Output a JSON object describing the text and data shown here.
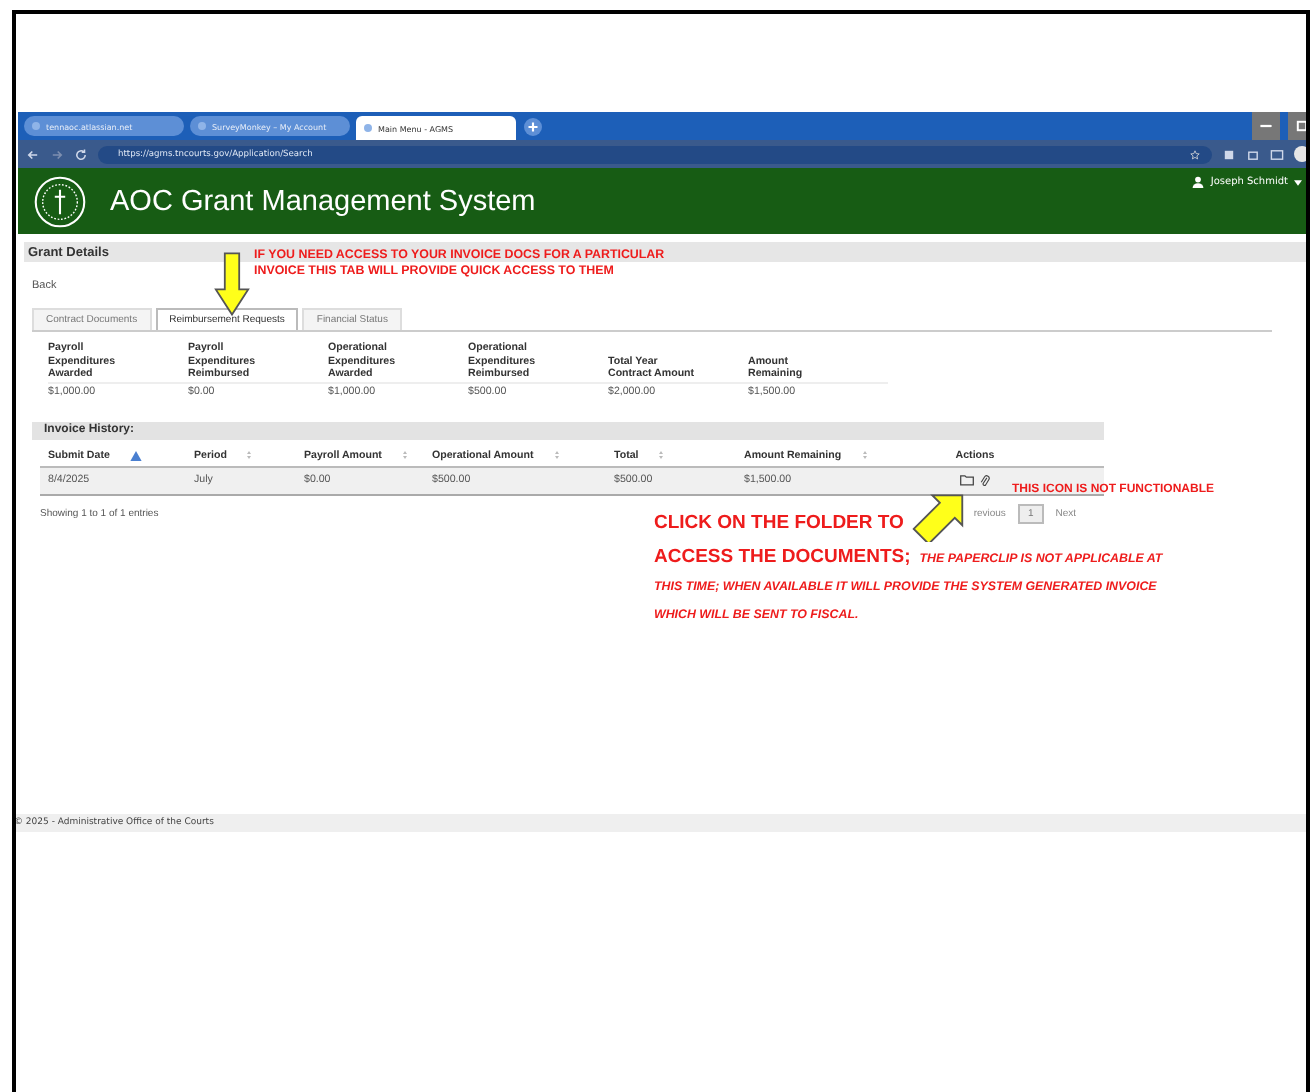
{
  "browser": {
    "tabs": [
      {
        "label": "tennaoc.atlassian.net",
        "selected": false
      },
      {
        "label": "SurveyMonkey – My Account",
        "selected": false
      },
      {
        "label": "Main Menu - AGMS",
        "selected": true
      }
    ],
    "url": "https://agms.tncourts.gov/Application/Search"
  },
  "app": {
    "title": "AOC Grant Management System",
    "user": "Joseph Schmidt"
  },
  "page": {
    "heading": "Grant Details",
    "back": "Back",
    "tabs": [
      {
        "label": "Contract Documents",
        "selected": false
      },
      {
        "label": "Reimbursement Requests",
        "selected": true
      },
      {
        "label": "Financial Status",
        "selected": false
      }
    ],
    "summary": [
      {
        "label": "Payroll Expenditures Awarded",
        "value": "$1,000.00"
      },
      {
        "label": "Payroll Expenditures Reimbursed",
        "value": "$0.00"
      },
      {
        "label": "Operational Expenditures Awarded",
        "value": "$1,000.00"
      },
      {
        "label": "Operational Expenditures Reimbursed",
        "value": "$500.00"
      },
      {
        "label": "Total Year Contract Amount",
        "value": "$2,000.00"
      },
      {
        "label": "Amount Remaining",
        "value": "$1,500.00"
      }
    ],
    "invoice_title": "Invoice History:",
    "table": {
      "columns": [
        {
          "label": "Submit Date",
          "sortable": true,
          "sorted": true
        },
        {
          "label": "Period",
          "sortable": true,
          "sorted": false
        },
        {
          "label": "Payroll Amount",
          "sortable": true,
          "sorted": false
        },
        {
          "label": "Operational Amount",
          "sortable": true,
          "sorted": false
        },
        {
          "label": "Total",
          "sortable": true,
          "sorted": false
        },
        {
          "label": "Amount Remaining",
          "sortable": true,
          "sorted": false
        },
        {
          "label": "Actions",
          "sortable": false
        }
      ],
      "rows": [
        {
          "cells": [
            "8/4/2025",
            "July",
            "$0.00",
            "$500.00",
            "$500.00",
            "$1,500.00"
          ]
        }
      ]
    },
    "showing": "Showing 1 to 1 of 1 entries",
    "pagination": {
      "previous": "revious",
      "pages": [
        {
          "label": "1",
          "selected": true
        }
      ],
      "next": "Next"
    },
    "footer": "© 2025 - Administrative Office of the Courts"
  },
  "annotations": {
    "tab_note": "IF YOU NEED ACCESS TO YOUR INVOICE DOCS FOR A PARTICULAR INVOICE THIS TAB WILL PROVIDE QUICK ACCESS TO THEM",
    "icon_note": "THIS ICON IS NOT FUNCTIONABLE",
    "folder_lead": "CLICK ON THE FOLDER TO",
    "folder_lead_2": "ACCESS THE DOCUMENTS;",
    "folder_note": "THE PAPERCLIP IS NOT APPLICABLE AT THIS TIME; WHEN AVAILABLE IT WILL PROVIDE THE SYSTEM GENERATED INVOICE WHICH WILL BE SENT TO FISCAL."
  }
}
